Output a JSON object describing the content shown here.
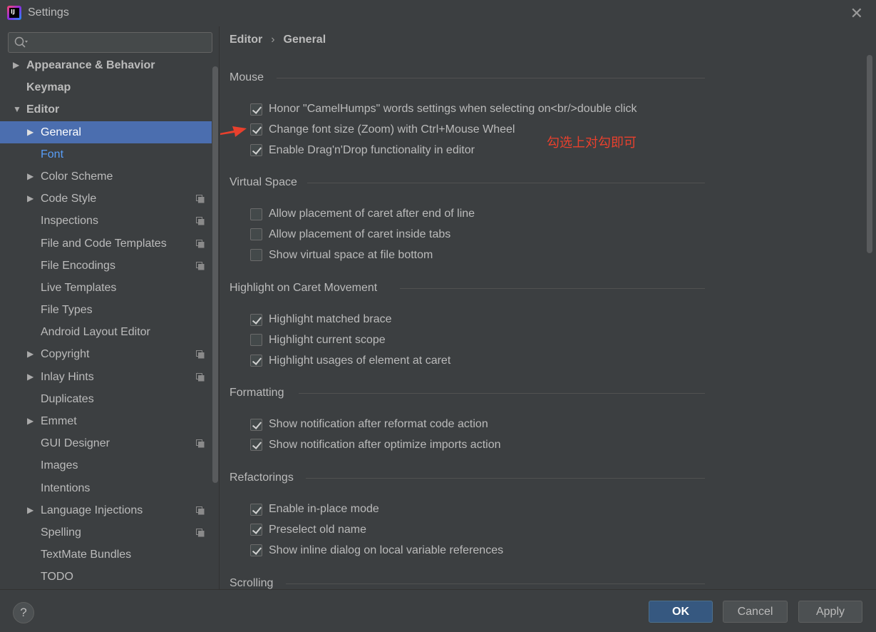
{
  "window": {
    "title": "Settings",
    "close_glyph": "✕",
    "logo_text": "IJ"
  },
  "search": {
    "placeholder": "",
    "value": ""
  },
  "sidebar": {
    "items": [
      {
        "label": "Appearance & Behavior",
        "arrow": "▶",
        "level": 0,
        "bold": true,
        "copy": false,
        "state": "normal"
      },
      {
        "label": "Keymap",
        "arrow": "",
        "level": 0,
        "bold": true,
        "copy": false,
        "state": "normal"
      },
      {
        "label": "Editor",
        "arrow": "▼",
        "level": 0,
        "bold": true,
        "copy": false,
        "state": "normal"
      },
      {
        "label": "General",
        "arrow": "▶",
        "level": 1,
        "bold": false,
        "copy": false,
        "state": "selected"
      },
      {
        "label": "Font",
        "arrow": "",
        "level": 1,
        "bold": false,
        "copy": false,
        "state": "link"
      },
      {
        "label": "Color Scheme",
        "arrow": "▶",
        "level": 1,
        "bold": false,
        "copy": false,
        "state": "normal"
      },
      {
        "label": "Code Style",
        "arrow": "▶",
        "level": 1,
        "bold": false,
        "copy": true,
        "state": "normal"
      },
      {
        "label": "Inspections",
        "arrow": "",
        "level": 1,
        "bold": false,
        "copy": true,
        "state": "normal"
      },
      {
        "label": "File and Code Templates",
        "arrow": "",
        "level": 1,
        "bold": false,
        "copy": true,
        "state": "normal"
      },
      {
        "label": "File Encodings",
        "arrow": "",
        "level": 1,
        "bold": false,
        "copy": true,
        "state": "normal"
      },
      {
        "label": "Live Templates",
        "arrow": "",
        "level": 1,
        "bold": false,
        "copy": false,
        "state": "normal"
      },
      {
        "label": "File Types",
        "arrow": "",
        "level": 1,
        "bold": false,
        "copy": false,
        "state": "normal"
      },
      {
        "label": "Android Layout Editor",
        "arrow": "",
        "level": 1,
        "bold": false,
        "copy": false,
        "state": "normal"
      },
      {
        "label": "Copyright",
        "arrow": "▶",
        "level": 1,
        "bold": false,
        "copy": true,
        "state": "normal"
      },
      {
        "label": "Inlay Hints",
        "arrow": "▶",
        "level": 1,
        "bold": false,
        "copy": true,
        "state": "normal"
      },
      {
        "label": "Duplicates",
        "arrow": "",
        "level": 1,
        "bold": false,
        "copy": false,
        "state": "normal"
      },
      {
        "label": "Emmet",
        "arrow": "▶",
        "level": 1,
        "bold": false,
        "copy": false,
        "state": "normal"
      },
      {
        "label": "GUI Designer",
        "arrow": "",
        "level": 1,
        "bold": false,
        "copy": true,
        "state": "normal"
      },
      {
        "label": "Images",
        "arrow": "",
        "level": 1,
        "bold": false,
        "copy": false,
        "state": "normal"
      },
      {
        "label": "Intentions",
        "arrow": "",
        "level": 1,
        "bold": false,
        "copy": false,
        "state": "normal"
      },
      {
        "label": "Language Injections",
        "arrow": "▶",
        "level": 1,
        "bold": false,
        "copy": true,
        "state": "normal"
      },
      {
        "label": "Spelling",
        "arrow": "",
        "level": 1,
        "bold": false,
        "copy": true,
        "state": "normal"
      },
      {
        "label": "TextMate Bundles",
        "arrow": "",
        "level": 1,
        "bold": false,
        "copy": false,
        "state": "normal"
      },
      {
        "label": "TODO",
        "arrow": "",
        "level": 1,
        "bold": false,
        "copy": false,
        "state": "normal"
      }
    ]
  },
  "breadcrumb": {
    "parent": "Editor",
    "separator": "›",
    "current": "General"
  },
  "sections": [
    {
      "title": "Mouse",
      "options": [
        {
          "label": "Honor \"CamelHumps\" words settings when selecting on<br/>double click",
          "checked": true
        },
        {
          "label": "Change font size (Zoom) with Ctrl+Mouse Wheel",
          "checked": true
        },
        {
          "label": "Enable Drag'n'Drop functionality in editor",
          "checked": true
        }
      ]
    },
    {
      "title": "Virtual Space",
      "options": [
        {
          "label": "Allow placement of caret after end of line",
          "checked": false
        },
        {
          "label": "Allow placement of caret inside tabs",
          "checked": false
        },
        {
          "label": "Show virtual space at file bottom",
          "checked": false
        }
      ]
    },
    {
      "title": "Highlight on Caret Movement",
      "options": [
        {
          "label": "Highlight matched brace",
          "checked": true
        },
        {
          "label": "Highlight current scope",
          "checked": false
        },
        {
          "label": "Highlight usages of element at caret",
          "checked": true
        }
      ]
    },
    {
      "title": "Formatting",
      "options": [
        {
          "label": "Show notification after reformat code action",
          "checked": true
        },
        {
          "label": "Show notification after optimize imports action",
          "checked": true
        }
      ]
    },
    {
      "title": "Refactorings",
      "options": [
        {
          "label": "Enable in-place mode",
          "checked": true
        },
        {
          "label": "Preselect old name",
          "checked": true
        },
        {
          "label": "Show inline dialog on local variable references",
          "checked": true
        }
      ]
    },
    {
      "title": "Scrolling",
      "options": []
    }
  ],
  "annotation": {
    "text": "勾选上对勾即可",
    "color": "#e8402d"
  },
  "footer": {
    "help": "?",
    "ok": "OK",
    "cancel": "Cancel",
    "apply": "Apply"
  },
  "colors": {
    "accent": "#4b6eaf",
    "primary_button": "#365880",
    "link": "#589df6",
    "background": "#3c3f41"
  }
}
